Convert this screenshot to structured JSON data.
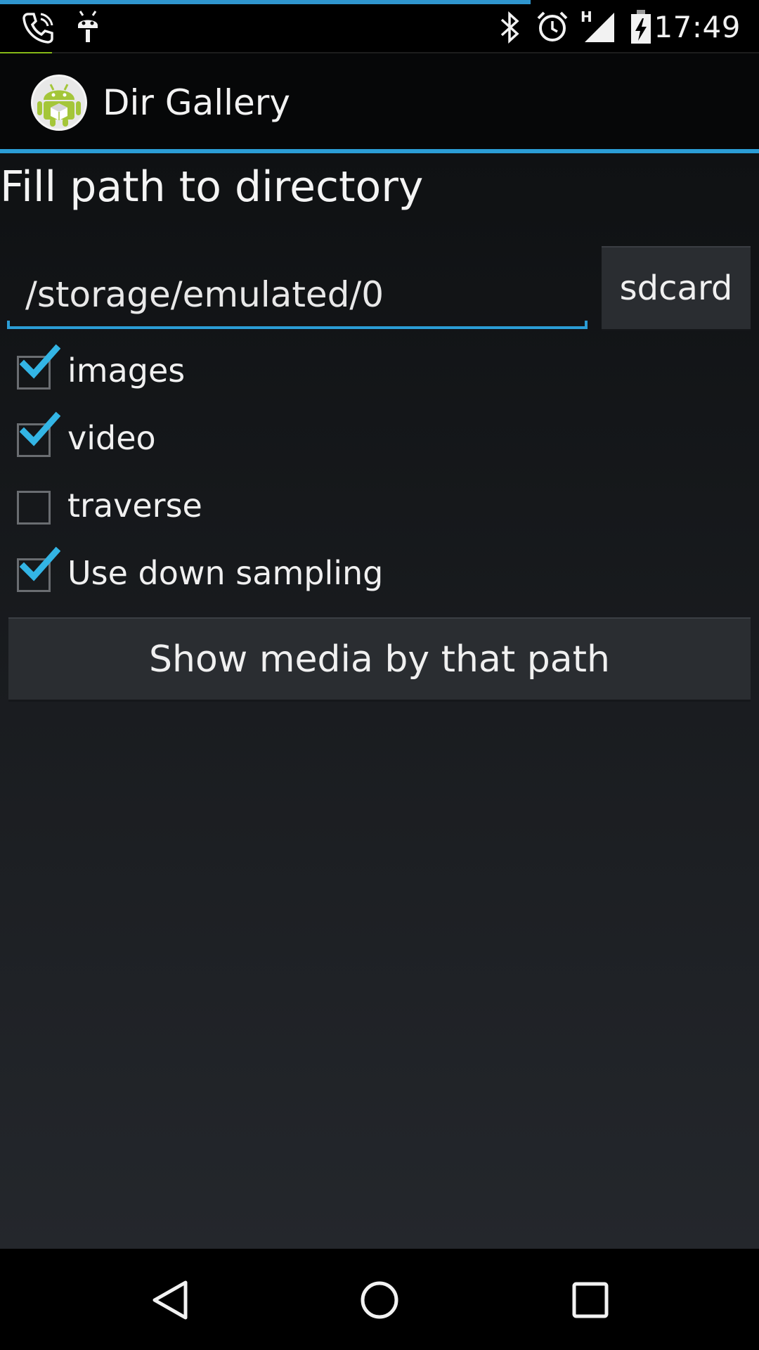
{
  "status_bar": {
    "time": "17:49",
    "left_icons": [
      "phone-icon",
      "android-debug-icon"
    ],
    "right_icons": [
      "bluetooth-icon",
      "alarm-icon",
      "signal-icon",
      "battery-icon"
    ],
    "network_label": "H"
  },
  "action_bar": {
    "title": "Dir Gallery",
    "icon": "android-app-icon"
  },
  "main": {
    "heading": "Fill path to directory",
    "path_value": "/storage/emulated/0",
    "sdcard_label": "sdcard",
    "options": [
      {
        "label": "images",
        "checked": true
      },
      {
        "label": "video",
        "checked": true
      },
      {
        "label": "traverse",
        "checked": false
      },
      {
        "label": "Use down sampling",
        "checked": true
      }
    ],
    "show_button_label": "Show media by that path"
  },
  "nav_bar": {
    "buttons": [
      "back-icon",
      "home-icon",
      "recents-icon"
    ]
  },
  "colors": {
    "accent": "#2b9dd6",
    "check": "#33b5e5",
    "android_green": "#a4c639"
  }
}
